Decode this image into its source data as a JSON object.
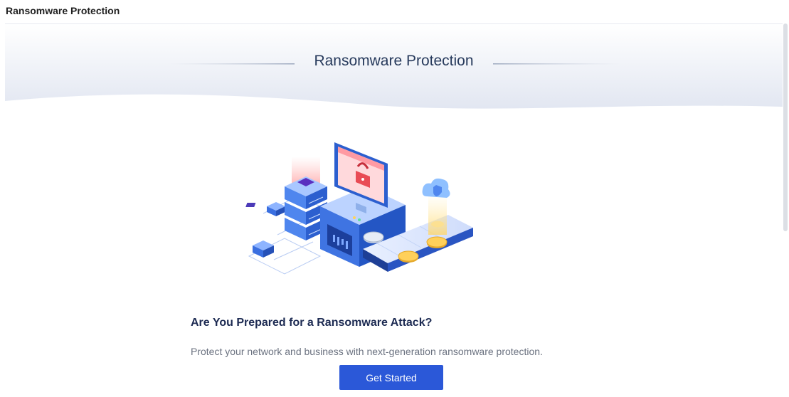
{
  "page": {
    "title": "Ransomware Protection"
  },
  "banner": {
    "title": "Ransomware Protection"
  },
  "content": {
    "headline": "Are You Prepared for a Ransomware Attack?",
    "description": "Protect your network and business with next-generation ransomware protection.",
    "cta_label": "Get Started"
  },
  "illustration": {
    "icons": [
      "server-stack-icon",
      "computer-monitor-icon",
      "padlock-icon",
      "cloud-shield-icon",
      "coin-icon",
      "conveyor-belt-icon"
    ]
  },
  "colors": {
    "accent": "#2b58d8",
    "title_text": "#273a5c",
    "headline_text": "#1c2a52",
    "body_text": "#6b7280",
    "lock_red": "#e94b55"
  }
}
